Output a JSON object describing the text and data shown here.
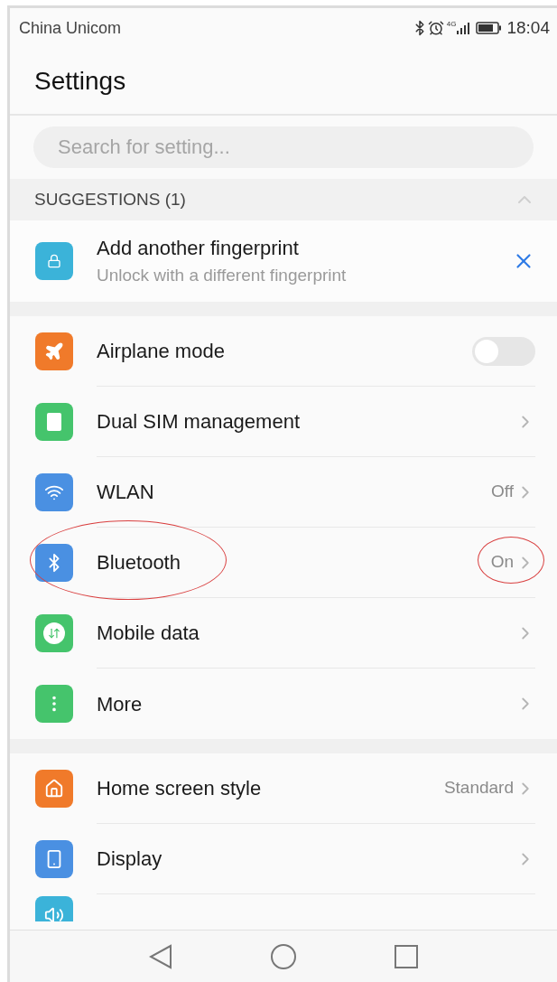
{
  "status_bar": {
    "carrier": "China Unicom",
    "network": "4G",
    "time": "18:04"
  },
  "title": "Settings",
  "search": {
    "placeholder": "Search for setting..."
  },
  "suggestions": {
    "header": "SUGGESTIONS (1)",
    "expanded": true,
    "items": [
      {
        "title": "Add another fingerprint",
        "subtitle": "Unlock with a different fingerprint"
      }
    ]
  },
  "groups": [
    {
      "items": [
        {
          "kind": "toggle",
          "label": "Airplane mode",
          "on": false,
          "circled": false
        },
        {
          "kind": "link",
          "label": "Dual SIM management",
          "circled": false
        },
        {
          "kind": "link",
          "label": "WLAN",
          "value": "Off",
          "circled": false
        },
        {
          "kind": "link",
          "label": "Bluetooth",
          "value": "On",
          "circled": true
        },
        {
          "kind": "link",
          "label": "Mobile data",
          "circled": false
        },
        {
          "kind": "link",
          "label": "More",
          "circled": false
        }
      ]
    },
    {
      "items": [
        {
          "kind": "link",
          "label": "Home screen style",
          "value": "Standard",
          "circled": false
        },
        {
          "kind": "link",
          "label": "Display",
          "circled": false
        },
        {
          "kind": "cut"
        }
      ]
    }
  ]
}
